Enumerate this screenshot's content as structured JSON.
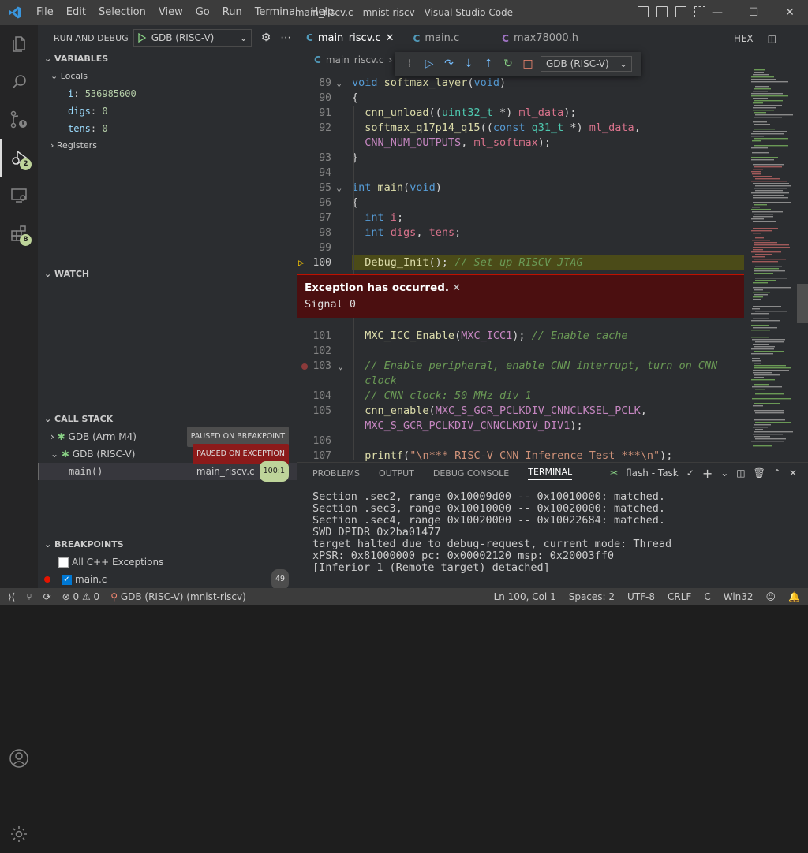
{
  "titlebar": {
    "menu": [
      "File",
      "Edit",
      "Selection",
      "View",
      "Go",
      "Run",
      "Terminal",
      "Help"
    ],
    "title": "main_riscv.c - mnist-riscv - Visual Studio Code"
  },
  "activity": {
    "debug_badge": "2",
    "ext_badge": "8"
  },
  "sidebar": {
    "header": "RUN AND DEBUG",
    "config": "GDB (RISC-V)",
    "variables": "VARIABLES",
    "locals": "Locals",
    "vars": [
      {
        "name": "i",
        "value": "536985600"
      },
      {
        "name": "digs",
        "value": "0"
      },
      {
        "name": "tens",
        "value": "0"
      }
    ],
    "registers": "Registers",
    "watch": "WATCH",
    "callstack": "CALL STACK",
    "threads": [
      {
        "name": "GDB (Arm M4)",
        "state": "PAUSED ON BREAKPOINT"
      },
      {
        "name": "GDB (RISC-V)",
        "state": "PAUSED ON EXCEPTION"
      }
    ],
    "frame": {
      "name": "main()",
      "file": "main_riscv.c",
      "pos": "100:1"
    },
    "breakpoints": "BREAKPOINTS",
    "bp_items": [
      {
        "label": "All C++ Exceptions"
      },
      {
        "label": "main.c",
        "count": "49"
      }
    ]
  },
  "editor": {
    "tabs": [
      "main_riscv.c",
      "main.c",
      "max78000.h"
    ],
    "hex": "HEX",
    "breadcrumb": "main_riscv.c",
    "toolbar_config": "GDB (RISC-V)",
    "lines": [
      {
        "n": "89",
        "html": "<span class='kw'>void</span> <span class='fn'>softmax_layer</span>(<span class='kw'>void</span>)"
      },
      {
        "n": "90",
        "html": "{"
      },
      {
        "n": "91",
        "html": "  <span class='fn'>cnn_unload</span>((<span class='ty'>uint32_t</span> *) <span class='id'>ml_data</span>);"
      },
      {
        "n": "92",
        "html": "  <span class='fn'>softmax_q17p14_q15</span>((<span class='kw'>const</span> <span class='ty'>q31_t</span> *) <span class='id'>ml_data</span>,"
      },
      {
        "n": "",
        "html": "  <span class='mac'>CNN_NUM_OUTPUTS</span>, <span class='id'>ml_softmax</span>);"
      },
      {
        "n": "93",
        "html": "}"
      },
      {
        "n": "94",
        "html": ""
      },
      {
        "n": "95",
        "html": "<span class='kw'>int</span> <span class='fn'>main</span>(<span class='kw'>void</span>)"
      },
      {
        "n": "96",
        "html": "{"
      },
      {
        "n": "97",
        "html": "  <span class='kw'>int</span> <span class='id'>i</span>;"
      },
      {
        "n": "98",
        "html": "  <span class='kw'>int</span> <span class='id'>digs</span>, <span class='id'>tens</span>;"
      },
      {
        "n": "99",
        "html": ""
      },
      {
        "n": "100",
        "html": "  <span class='fn'>Debug_Init</span>(); <span class='cm'>// Set up RISCV JTAG</span>"
      }
    ],
    "lines2": [
      {
        "n": "101",
        "html": "  <span class='fn'>MXC_ICC_Enable</span>(<span class='mac'>MXC_ICC1</span>); <span class='cm'>// Enable cache</span>"
      },
      {
        "n": "102",
        "html": ""
      },
      {
        "n": "103",
        "html": "  <span class='cm'>// Enable peripheral, enable CNN interrupt, turn on CNN</span>"
      },
      {
        "n": "",
        "html": "  <span class='cm'>clock</span>"
      },
      {
        "n": "104",
        "html": "  <span class='cm'>// CNN clock: 50 MHz div 1</span>"
      },
      {
        "n": "105",
        "html": "  <span class='fn'>cnn_enable</span>(<span class='mac'>MXC_S_GCR_PCLKDIV_CNNCLKSEL_PCLK</span>,"
      },
      {
        "n": "",
        "html": "  <span class='mac'>MXC_S_GCR_PCLKDIV_CNNCLKDIV_DIV1</span>);"
      },
      {
        "n": "106",
        "html": ""
      },
      {
        "n": "107",
        "html": "  <span class='fn'>printf</span>(<span class='st'>\"\\n*** RISC-V CNN Inference Test ***\\n\"</span>);"
      }
    ],
    "exception": {
      "title": "Exception has occurred.",
      "detail": "Signal 0"
    }
  },
  "panel": {
    "tabs": [
      "PROBLEMS",
      "OUTPUT",
      "DEBUG CONSOLE",
      "TERMINAL"
    ],
    "task": "flash - Task",
    "terminal": [
      "Section .sec2, range 0x10009d00 -- 0x10010000: matched.",
      "Section .sec3, range 0x10010000 -- 0x10020000: matched.",
      "Section .sec4, range 0x10020000 -- 0x10022684: matched.",
      "SWD DPIDR 0x2ba01477",
      "target halted due to debug-request, current mode: Thread",
      "xPSR: 0x81000000 pc: 0x00002120 msp: 0x20003ff0",
      "[Inferior 1 (Remote target) detached]"
    ]
  },
  "status": {
    "errors": "0",
    "warnings": "0",
    "debug": "GDB (RISC-V) (mnist-riscv)",
    "pos": "Ln 100, Col 1",
    "spaces": "Spaces: 2",
    "enc": "UTF-8",
    "eol": "CRLF",
    "lang": "C",
    "plat": "Win32"
  }
}
